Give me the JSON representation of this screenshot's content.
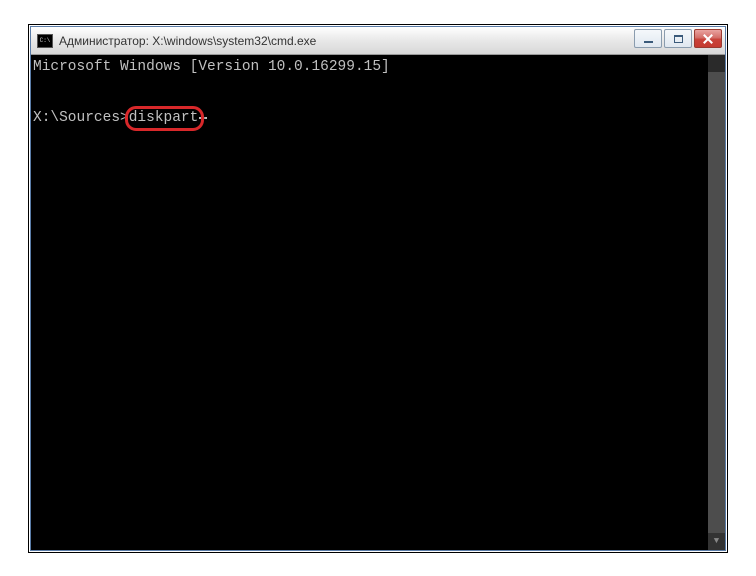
{
  "window": {
    "title": "Администратор: X:\\windows\\system32\\cmd.exe",
    "icon_label": "C:\\"
  },
  "terminal": {
    "version_line": "Microsoft Windows [Version 10.0.16299.15]",
    "prompt": "X:\\Sources>",
    "command": "diskpart"
  }
}
